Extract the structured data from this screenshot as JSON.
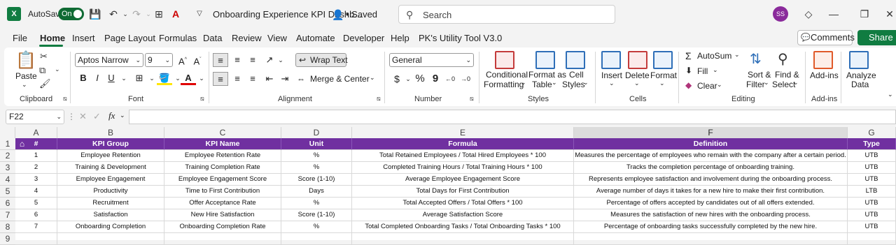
{
  "titlebar": {
    "app_logo": "X",
    "autosave_label": "AutoSave",
    "autosave_state": "On",
    "doc_title": "Onboarding Experience KPI Dashb...",
    "saved_label": "• Saved",
    "search_placeholder": "Search",
    "user_initials": "SS"
  },
  "menu": {
    "items": [
      "File",
      "Home",
      "Insert",
      "Page Layout",
      "Formulas",
      "Data",
      "Review",
      "View",
      "Automate",
      "Developer",
      "Help",
      "PK's Utility Tool V3.0"
    ],
    "active": "Home",
    "comments_label": "Comments",
    "share_label": "Share"
  },
  "ribbon": {
    "clipboard": {
      "paste": "Paste",
      "group": "Clipboard"
    },
    "font": {
      "name": "Aptos Narrow",
      "size": "9",
      "group": "Font",
      "bold": "B",
      "italic": "I",
      "underline": "U",
      "grow": "A^",
      "shrink": "Aˇ"
    },
    "alignment": {
      "wrap": "Wrap Text",
      "merge": "Merge & Center",
      "group": "Alignment"
    },
    "number": {
      "format": "General",
      "currency": "$",
      "percent": "%",
      "comma": "9",
      "group": "Number"
    },
    "styles": {
      "conditional": [
        "Conditional",
        "Formatting"
      ],
      "format_table": [
        "Format as",
        "Table"
      ],
      "cell_styles": [
        "Cell",
        "Styles"
      ],
      "group": "Styles"
    },
    "cells": {
      "insert": "Insert",
      "delete": "Delete",
      "format": "Format",
      "group": "Cells"
    },
    "editing": {
      "autosum": "AutoSum",
      "fill": "Fill",
      "clear": "Clear",
      "sort": [
        "Sort &",
        "Filter"
      ],
      "find": [
        "Find &",
        "Select"
      ],
      "group": "Editing"
    },
    "addins": {
      "label": "Add-ins",
      "group": "Add-ins"
    },
    "analyze": {
      "label": [
        "Analyze",
        "Data"
      ]
    }
  },
  "formula_bar": {
    "name_box": "F22",
    "fx": "fx",
    "value": ""
  },
  "columns": [
    "A",
    "B",
    "C",
    "D",
    "E",
    "F",
    "G"
  ],
  "rows": [
    "1",
    "2",
    "3",
    "4",
    "5",
    "6",
    "7",
    "8",
    "9"
  ],
  "table": {
    "headers": [
      "#",
      "KPI Group",
      "KPI Name",
      "Unit",
      "Formula",
      "Definition",
      "Type"
    ],
    "rows": [
      [
        "1",
        "Employee Retention",
        "Employee Retention Rate",
        "%",
        "Total Retained Employees / Total Hired Employees * 100",
        "Measures the percentage of employees who remain with the company after a certain period.",
        "UTB"
      ],
      [
        "2",
        "Training & Development",
        "Training Completion Rate",
        "%",
        "Completed Training Hours / Total Training Hours * 100",
        "Tracks the completion percentage of onboarding training.",
        "UTB"
      ],
      [
        "3",
        "Employee Engagement",
        "Employee Engagement Score",
        "Score (1-10)",
        "Average Employee Engagement Score",
        "Represents employee satisfaction and involvement during the onboarding process.",
        "UTB"
      ],
      [
        "4",
        "Productivity",
        "Time to First Contribution",
        "Days",
        "Total Days for First Contribution",
        "Average number of days it takes for a new hire to make their first contribution.",
        "LTB"
      ],
      [
        "5",
        "Recruitment",
        "Offer Acceptance Rate",
        "%",
        "Total Accepted Offers / Total Offers * 100",
        "Percentage of offers accepted by candidates out of all offers extended.",
        "UTB"
      ],
      [
        "6",
        "Satisfaction",
        "New Hire Satisfaction",
        "Score (1-10)",
        "Average Satisfaction Score",
        "Measures the satisfaction of new hires with the onboarding process.",
        "UTB"
      ],
      [
        "7",
        "Onboarding Completion",
        "Onboarding Completion Rate",
        "%",
        "Total Completed Onboarding Tasks / Total Onboarding Tasks * 100",
        "Percentage of onboarding tasks successfully completed by the new hire.",
        "UTB"
      ]
    ]
  },
  "colors": {
    "header_fill": "#7030a0",
    "brand": "#107c41"
  }
}
